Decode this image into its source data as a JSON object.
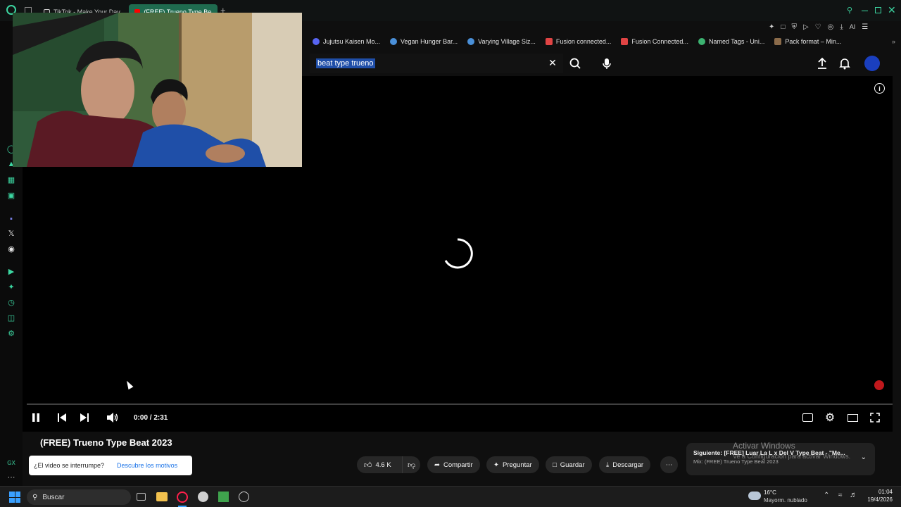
{
  "browser": {
    "tabs": [
      {
        "label": "TikTok - Make Your Day",
        "active": false
      },
      {
        "label": "(FREE) Trueno Type Beat",
        "active": true
      }
    ],
    "new_tab_symbol": "+",
    "right_ai_label": "AI",
    "bookmarks": [
      {
        "label": "Jujutsu Kaisen Mo...",
        "icon": "chat-icon",
        "color": "#5865f2"
      },
      {
        "label": "Vegan Hunger Bar...",
        "icon": "globe-icon",
        "color": "#4a90d9"
      },
      {
        "label": "Varying Village Siz...",
        "icon": "globe-icon",
        "color": "#4a90d9"
      },
      {
        "label": "Fusion connected...",
        "icon": "fusion-icon",
        "color": "#e04444"
      },
      {
        "label": "Fusion Connected...",
        "icon": "fusion-icon",
        "color": "#e04444"
      },
      {
        "label": "Named Tags - Uni...",
        "icon": "globe-icon",
        "color": "#3cb371"
      },
      {
        "label": "Pack format – Min...",
        "icon": "cube-icon",
        "color": "#8b6b4a"
      }
    ]
  },
  "youtube": {
    "search_query": "beat type trueno",
    "video": {
      "title": "(FREE) Trueno Type Beat 2023",
      "time": "0:00 / 2:31",
      "progress": 0
    },
    "actions": {
      "likes": "4.6 K",
      "share": "Compartir",
      "ask": "Preguntar",
      "save": "Guardar",
      "download": "Descargar"
    },
    "toast": {
      "question": "¿El video se interrumpe?",
      "link": "Descubre los motivos"
    },
    "up_next": {
      "title": "Siguiente: [FREE] Luar La L x Del V Type Beat - \"Me...",
      "subtitle": "Mix: (FREE) Trueno Type Beat 2023"
    }
  },
  "watermark": {
    "line1": "Activar Windows",
    "line2": "Ve a Configuración para activar Windows."
  },
  "taskbar": {
    "search_placeholder": "Buscar",
    "weather_temp": "16°C",
    "weather_desc": "Mayorm. nublado",
    "time": "01:04",
    "date": "19/4/2026"
  }
}
